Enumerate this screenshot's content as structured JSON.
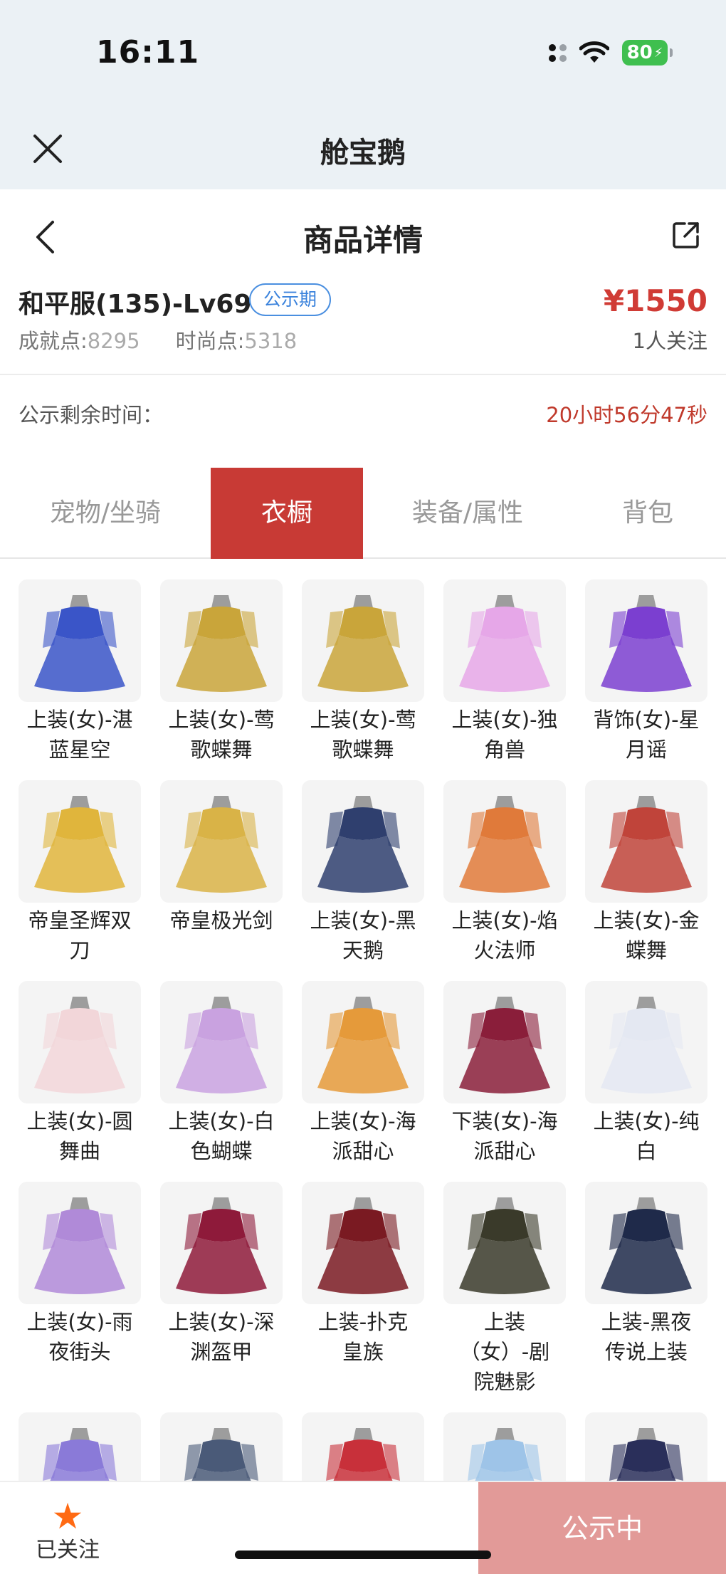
{
  "status_bar": {
    "time": "16:11",
    "battery": "80"
  },
  "webview": {
    "title": "舱宝鹅"
  },
  "header": {
    "title": "商品详情"
  },
  "product": {
    "name": "和平服(135)-Lv69",
    "badge": "公示期",
    "price": "¥1550",
    "achievement_label": "成就点:",
    "achievement_value": "8295",
    "fashion_label": "时尚点:",
    "fashion_value": "5318",
    "followers": "1人关注"
  },
  "countdown": {
    "label": "公示剩余时间：",
    "value": "20小时56分47秒"
  },
  "tabs": [
    {
      "label": "宠物/坐骑",
      "active": false
    },
    {
      "label": "衣橱",
      "active": true
    },
    {
      "label": "装备/属性",
      "active": false
    },
    {
      "label": "背包",
      "active": false
    }
  ],
  "wardrobe": [
    {
      "line1": "上装(女)-湛",
      "line2": "蓝星空",
      "line3": "",
      "color": "#3a55c8"
    },
    {
      "line1": "上装(女)-莺",
      "line2": "歌蝶舞",
      "line3": "",
      "color": "#c9a53a"
    },
    {
      "line1": "上装(女)-莺",
      "line2": "歌蝶舞",
      "line3": "",
      "color": "#c9a53a"
    },
    {
      "line1": "上装(女)-独",
      "line2": "角兽",
      "line3": "",
      "color": "#e6a7e8"
    },
    {
      "line1": "背饰(女)-星",
      "line2": "月谣",
      "line3": "",
      "color": "#7b3fd0"
    },
    {
      "line1": "帝皇圣辉双",
      "line2": "刀",
      "line3": "",
      "color": "#e0b53c"
    },
    {
      "line1": "帝皇极光剑",
      "line2": "",
      "line3": "",
      "color": "#d9b347"
    },
    {
      "line1": "上装(女)-黑",
      "line2": "天鹅",
      "line3": "",
      "color": "#2f3f6e"
    },
    {
      "line1": "上装(女)-焰",
      "line2": "火法师",
      "line3": "",
      "color": "#e07a3a"
    },
    {
      "line1": "上装(女)-金",
      "line2": "蝶舞",
      "line3": "",
      "color": "#c0443a"
    },
    {
      "line1": "上装(女)-圆",
      "line2": "舞曲",
      "line3": "",
      "color": "#f2d6d9"
    },
    {
      "line1": "上装(女)-白",
      "line2": "色蝴蝶",
      "line3": "",
      "color": "#c9a2e0"
    },
    {
      "line1": "上装(女)-海",
      "line2": "派甜心",
      "line3": "",
      "color": "#e59a3a"
    },
    {
      "line1": "下装(女)-海",
      "line2": "派甜心",
      "line3": "",
      "color": "#8a1e3a"
    },
    {
      "line1": "上装(女)-纯",
      "line2": "白",
      "line3": "",
      "color": "#e4e8f2"
    },
    {
      "line1": "上装(女)-雨",
      "line2": "夜街头",
      "line3": "",
      "color": "#b08ad8"
    },
    {
      "line1": "上装(女)-深",
      "line2": "渊盔甲",
      "line3": "",
      "color": "#8e1a3a"
    },
    {
      "line1": "上装-扑克",
      "line2": "皇族",
      "line3": "",
      "color": "#7a1a22"
    },
    {
      "line1": "上装",
      "line2": "（女）-剧",
      "line3": "院魅影",
      "color": "#3a3a2a"
    },
    {
      "line1": "上装-黑夜",
      "line2": "传说上装",
      "line3": "",
      "color": "#1f2a4a"
    },
    {
      "line1": "",
      "line2": "",
      "line3": "",
      "color": "#8a7ad8"
    },
    {
      "line1": "",
      "line2": "",
      "line3": "",
      "color": "#4a5a78"
    },
    {
      "line1": "",
      "line2": "",
      "line3": "",
      "color": "#c8303a"
    },
    {
      "line1": "",
      "line2": "",
      "line3": "",
      "color": "#9ec4e8"
    },
    {
      "line1": "",
      "line2": "",
      "line3": "",
      "color": "#2a2f5a"
    }
  ],
  "bottom_bar": {
    "follow_label": "已关注",
    "status_button": "公示中"
  },
  "colors": {
    "accent": "#c83a35",
    "price": "#d03b35",
    "badge_blue": "#3a82dc",
    "follow_star": "#ff6a13",
    "status_button": "#e29a98"
  }
}
